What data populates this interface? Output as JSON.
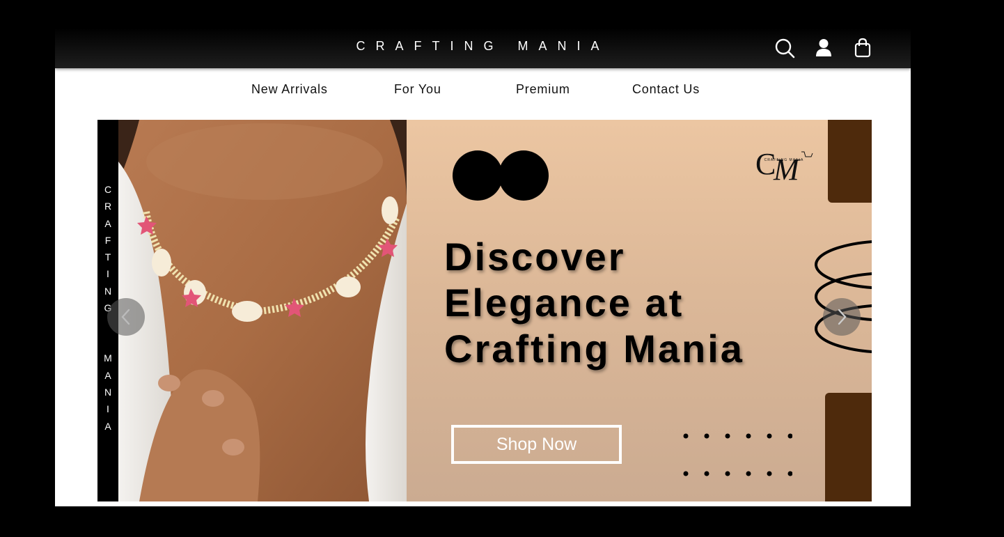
{
  "header": {
    "brand": "CRAFTING MANIA",
    "icons": [
      "search-icon",
      "user-icon",
      "shopping-bag-icon"
    ]
  },
  "nav": {
    "items": [
      "New Arrivals",
      "For You",
      "Premium",
      "Contact Us"
    ]
  },
  "hero": {
    "side_text_top": "CRAFTING",
    "side_text_bottom": "MANIA",
    "logo_text": "CRAFTING MANIA",
    "headline_lines": [
      "Discover",
      "Elegance at",
      "Crafting Mania"
    ],
    "cta_label": "Shop Now",
    "colors": {
      "accent_brown": "#4e2a0c",
      "peach": "#e7c3a1"
    }
  }
}
